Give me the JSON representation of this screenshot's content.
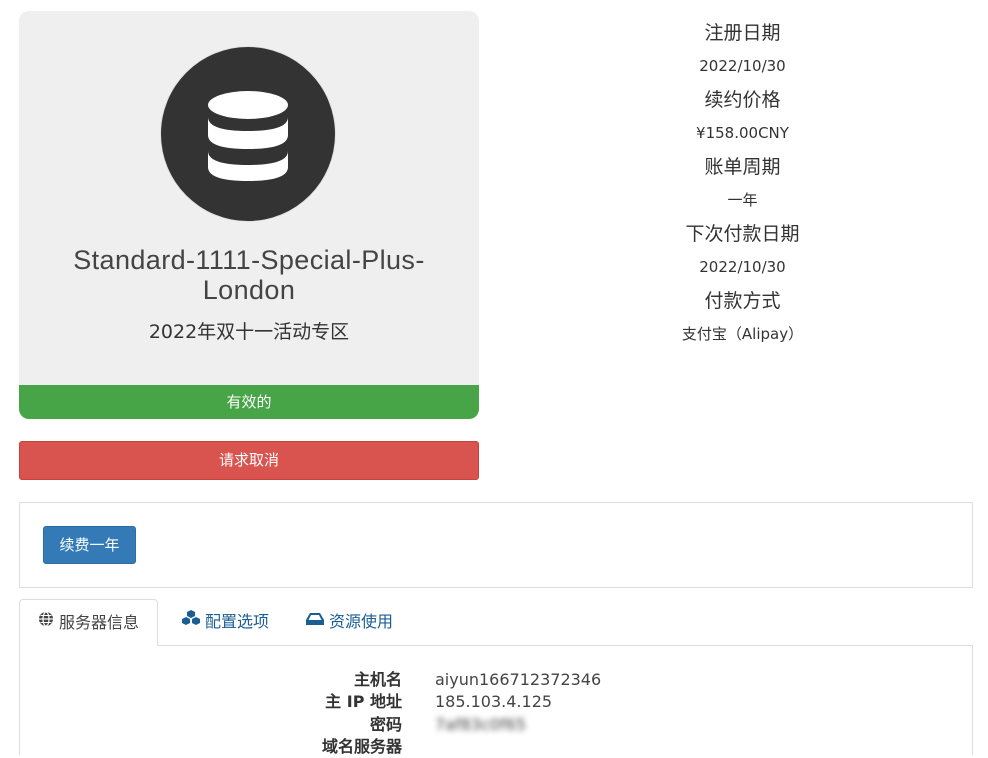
{
  "product": {
    "icon": "database-icon",
    "name": "Standard-1111-Special-Plus-London",
    "group": "2022年双十一活动专区",
    "status": "有效的",
    "status_color": "#47a447"
  },
  "actions": {
    "cancel_label": "请求取消",
    "cancel_color": "#d9534f",
    "renew_label": "续费一年",
    "renew_color": "#337ab7"
  },
  "billing": {
    "items": [
      {
        "label": "注册日期",
        "value": "2022/10/30"
      },
      {
        "label": "续约价格",
        "value": "¥158.00CNY"
      },
      {
        "label": "账单周期",
        "value": "一年"
      },
      {
        "label": "下次付款日期",
        "value": "2022/10/30"
      },
      {
        "label": "付款方式",
        "value": "支付宝（Alipay）"
      }
    ]
  },
  "tabs": [
    {
      "label": "服务器信息",
      "icon": "globe-icon",
      "active": true
    },
    {
      "label": "配置选项",
      "icon": "cubes-icon",
      "active": false
    },
    {
      "label": "资源使用",
      "icon": "drive-icon",
      "active": false
    }
  ],
  "server_info": {
    "rows": [
      {
        "label": "主机名",
        "value": "aiyun166712372346"
      },
      {
        "label": "主 IP 地址",
        "value": "185.103.4.125"
      },
      {
        "label": "密码",
        "value": "7af83c0f65"
      },
      {
        "label": "域名服务器",
        "value": ""
      }
    ]
  }
}
